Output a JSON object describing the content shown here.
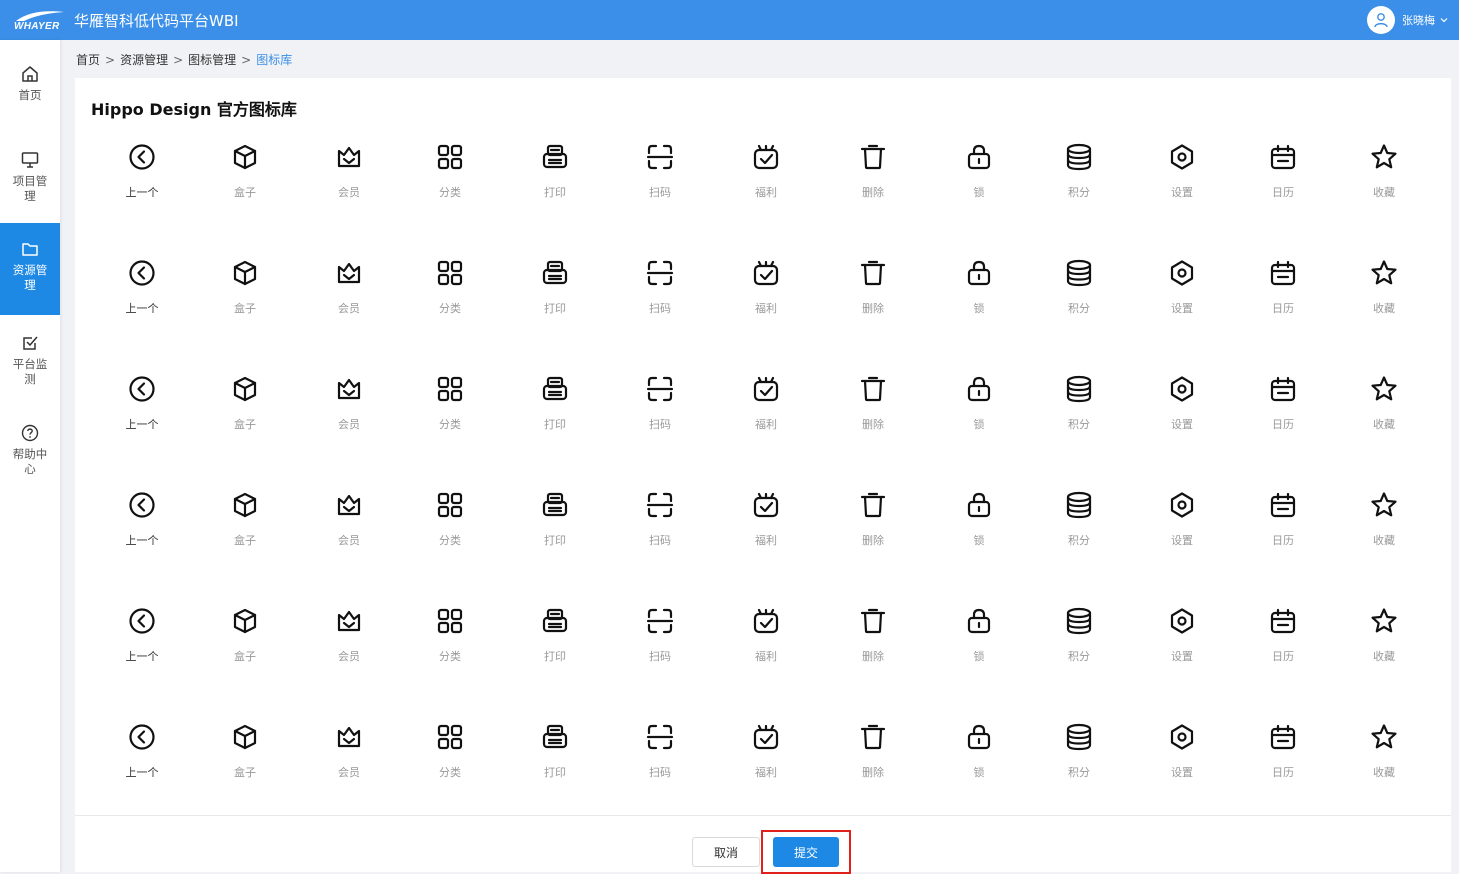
{
  "header": {
    "logo_text": "WHAYER",
    "title": "华雁智科低代码平台WBI",
    "user_name": "张晓梅"
  },
  "sidebar": {
    "items": [
      {
        "label": "首页",
        "icon": "home-icon",
        "active": false
      },
      {
        "label": "项目管理",
        "icon": "monitor-icon",
        "active": false
      },
      {
        "label": "资源管理",
        "icon": "folder-icon",
        "active": true
      },
      {
        "label": "平台监测",
        "icon": "checkbox-icon",
        "active": false
      },
      {
        "label": "帮助中心",
        "icon": "question-icon",
        "active": false
      }
    ]
  },
  "breadcrumb": [
    "首页",
    "资源管理",
    "图标管理",
    "图标库"
  ],
  "panel": {
    "title": "Hippo Design 官方图标库"
  },
  "icons": [
    {
      "label": "上一个",
      "icon": "prev-circle-icon"
    },
    {
      "label": "盒子",
      "icon": "box-icon"
    },
    {
      "label": "会员",
      "icon": "crown-icon"
    },
    {
      "label": "分类",
      "icon": "category-icon"
    },
    {
      "label": "打印",
      "icon": "print-icon"
    },
    {
      "label": "扫码",
      "icon": "scan-icon"
    },
    {
      "label": "福利",
      "icon": "gift-check-icon"
    },
    {
      "label": "删除",
      "icon": "trash-icon"
    },
    {
      "label": "锁",
      "icon": "lock-icon"
    },
    {
      "label": "积分",
      "icon": "coins-icon"
    },
    {
      "label": "设置",
      "icon": "settings-icon"
    },
    {
      "label": "日历",
      "icon": "calendar-icon"
    },
    {
      "label": "收藏",
      "icon": "star-icon"
    }
  ],
  "rows": 6,
  "footer": {
    "cancel_label": "取消",
    "submit_label": "提交"
  },
  "colors": {
    "brand": "#3b8fe8",
    "active_nav": "#1e88e5",
    "highlight": "#e0201a"
  }
}
